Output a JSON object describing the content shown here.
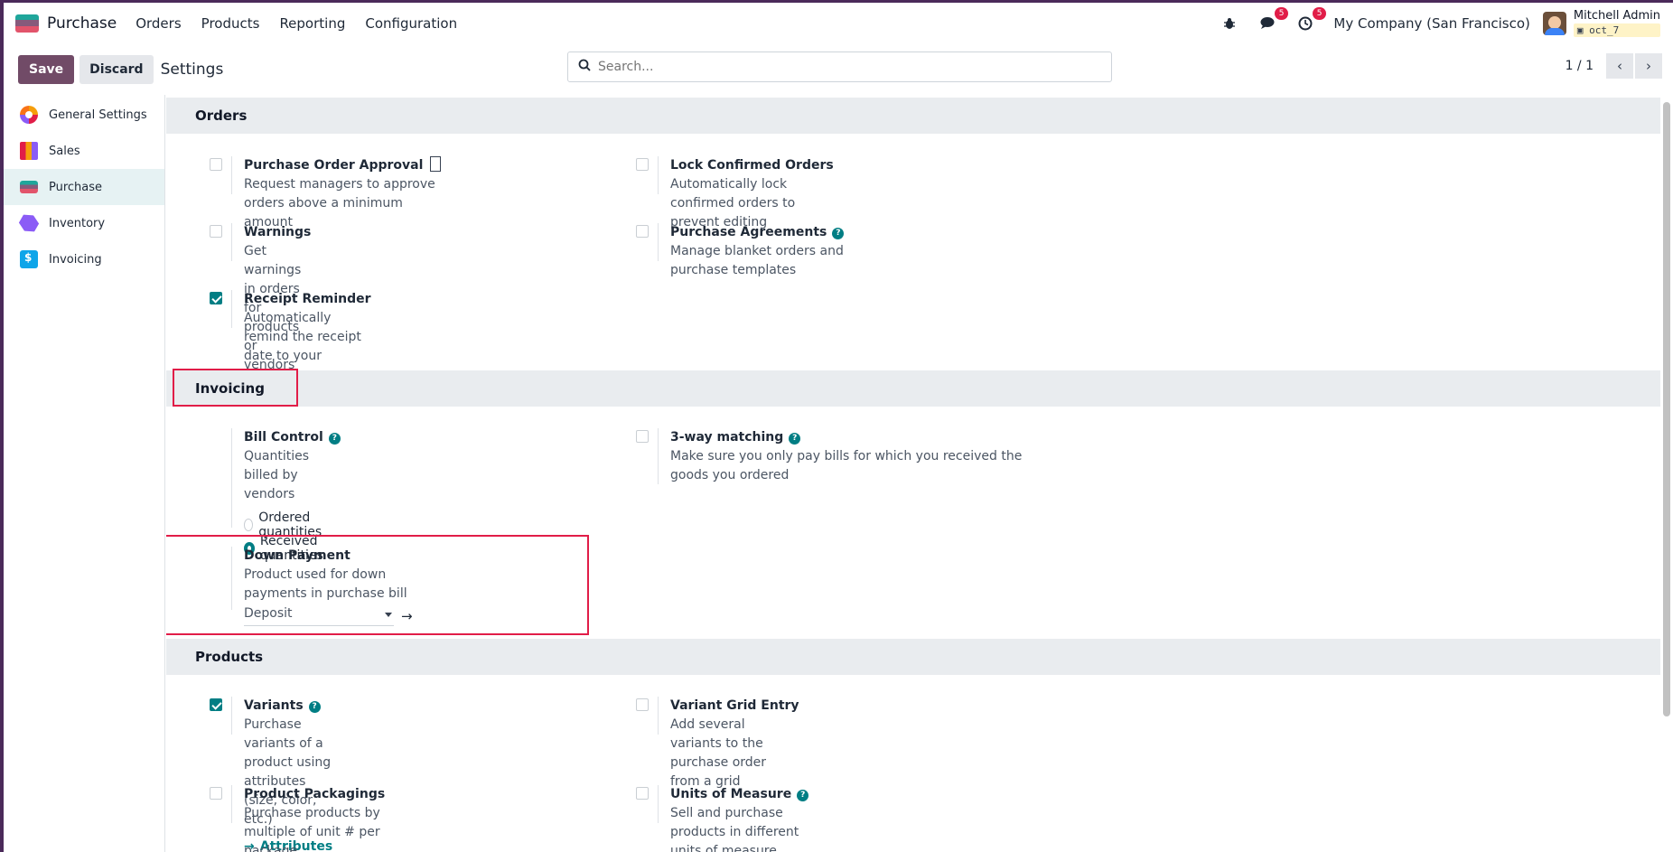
{
  "navbar": {
    "app_name": "Purchase",
    "menu": [
      "Orders",
      "Products",
      "Reporting",
      "Configuration"
    ],
    "messages_count": "5",
    "activities_count": "5",
    "company": "My Company (San Francisco)",
    "user_name": "Mitchell Admin",
    "database": "oct_7"
  },
  "control": {
    "save_label": "Save",
    "discard_label": "Discard",
    "breadcrumb": "Settings",
    "search_placeholder": "Search...",
    "pager": "1 / 1"
  },
  "sidebar": {
    "items": [
      {
        "label": "General Settings",
        "icon": "general-settings-icon"
      },
      {
        "label": "Sales",
        "icon": "sales-icon"
      },
      {
        "label": "Purchase",
        "icon": "purchase-icon",
        "active": true
      },
      {
        "label": "Inventory",
        "icon": "inventory-icon"
      },
      {
        "label": "Invoicing",
        "icon": "invoicing-icon"
      }
    ]
  },
  "sections": {
    "orders": {
      "title": "Orders",
      "purchase_order_approval": {
        "title": "Purchase Order Approval",
        "desc": "Request managers to approve orders above a minimum amount",
        "checked": false
      },
      "lock_confirmed_orders": {
        "title": "Lock Confirmed Orders",
        "desc": "Automatically lock confirmed orders to prevent editing",
        "checked": false
      },
      "warnings": {
        "title": "Warnings",
        "desc": "Get warnings in orders for products or vendors",
        "checked": false
      },
      "purchase_agreements": {
        "title": "Purchase Agreements",
        "desc": "Manage blanket orders and purchase templates",
        "checked": false
      },
      "receipt_reminder": {
        "title": "Receipt Reminder",
        "desc": "Automatically remind the receipt date to your vendors",
        "checked": true
      }
    },
    "invoicing": {
      "title": "Invoicing",
      "bill_control": {
        "title": "Bill Control",
        "desc": "Quantities billed by vendors",
        "options": [
          "Ordered quantities",
          "Received quantities"
        ],
        "selected": "Received quantities"
      },
      "three_way": {
        "title": "3-way matching",
        "desc": "Make sure you only pay bills for which you received the goods you ordered",
        "checked": false
      },
      "down_payment": {
        "title": "Down Payment",
        "desc": "Product used for down payments in purchase bill",
        "value": "Deposit"
      }
    },
    "products": {
      "title": "Products",
      "variants": {
        "title": "Variants",
        "desc": "Purchase variants of a product using attributes (size, color, etc.)",
        "checked": true,
        "link": "Attributes"
      },
      "variant_grid": {
        "title": "Variant Grid Entry",
        "desc": "Add several variants to the purchase order from a grid",
        "checked": false
      },
      "packagings": {
        "title": "Product Packagings",
        "desc": "Purchase products by multiple of unit # per package",
        "checked": false
      },
      "uom": {
        "title": "Units of Measure",
        "desc": "Sell and purchase products in different units of measure",
        "checked": false
      }
    }
  },
  "colors": {
    "brand": "#714b67",
    "accent": "#017e84",
    "highlight": "#e11d48"
  }
}
